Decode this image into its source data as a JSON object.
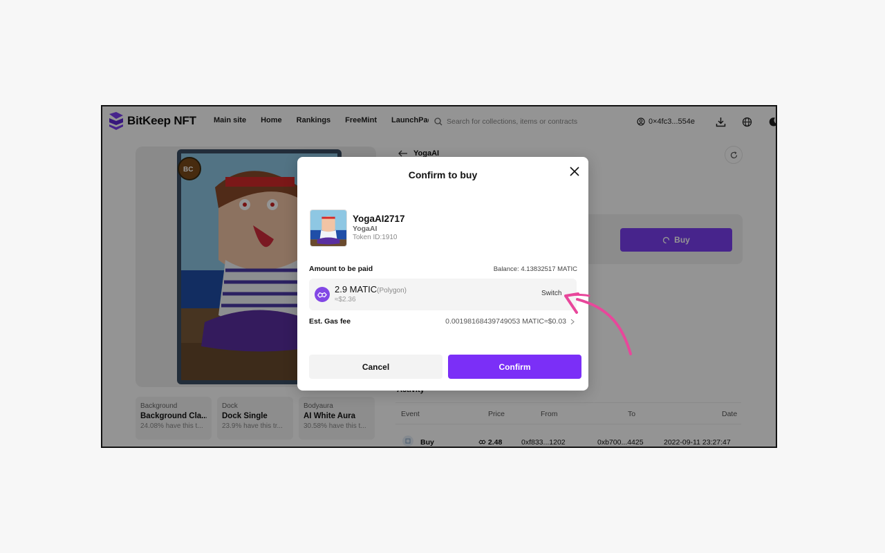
{
  "nav": {
    "brand": "BitKeep NFT",
    "links": [
      "Main site",
      "Home",
      "Rankings",
      "FreeMint",
      "LaunchPad"
    ],
    "search_placeholder": "Search for collections, items or contracts",
    "wallet_address": "0×4fc3...554e"
  },
  "page": {
    "back_title": "YogaAI",
    "buy_label": "Buy",
    "traits": [
      {
        "type": "Background",
        "value": "Background Cla...",
        "rarity": "24.08% have this t..."
      },
      {
        "type": "Dock",
        "value": "Dock Single",
        "rarity": "23.9% have this tr..."
      },
      {
        "type": "Bodyaura",
        "value": "AI White Aura",
        "rarity": "30.58% have this t..."
      }
    ],
    "activity_label": "Activity",
    "activity_headers": [
      "Event",
      "Price",
      "From",
      "To",
      "Date"
    ],
    "activity_rows": [
      {
        "event": "Buy",
        "price": "2.48",
        "from": "0xf833...1202",
        "to": "0xb700...4425",
        "date": "2022-09-11 23:27:47"
      }
    ]
  },
  "modal": {
    "title": "Confirm to buy",
    "item_name": "YogaAI2717",
    "collection": "YogaAI",
    "token_id": "Token ID:1910",
    "amount_label": "Amount to be paid",
    "balance": "Balance: 4.13832517 MATIC",
    "pay_amount": "2.9 MATIC",
    "pay_network": "(Polygon)",
    "pay_usd": "≈$2.36",
    "switch_label": "Switch",
    "gas_label": "Est. Gas fee",
    "gas_value": "0.00198168439749053 MATIC≈$0.03",
    "cancel_label": "Cancel",
    "confirm_label": "Confirm"
  },
  "colors": {
    "accent": "#7b2ff7",
    "polygon": "#8247e5",
    "annotation_arrow": "#e8479b"
  }
}
